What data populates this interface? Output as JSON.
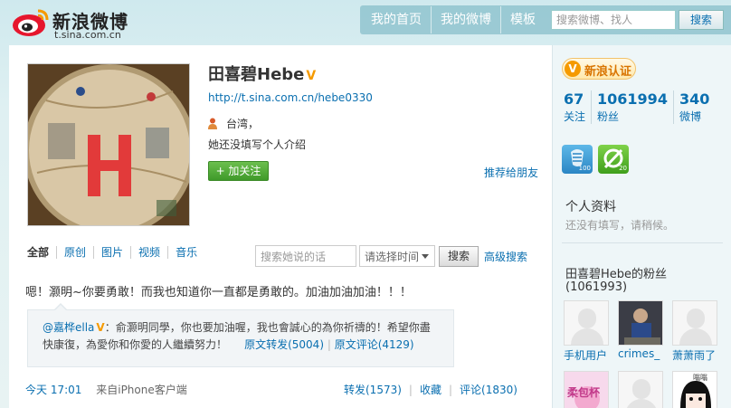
{
  "header": {
    "brand": "新浪微博",
    "site_url": "t.sina.com.cn",
    "nav": [
      "我的首页",
      "我的微博",
      "模板"
    ],
    "search_placeholder": "搜索微博、找人",
    "search_button": "搜索"
  },
  "profile": {
    "name": "田喜碧Hebe",
    "verified_mark": "V",
    "url": "http://t.sina.com.cn/hebe0330",
    "location": "台湾，",
    "bio": "她还没填写个人介绍",
    "follow_button": "+ 加关注",
    "recommend_link": "推荐给朋友"
  },
  "filters": {
    "tabs": [
      "全部",
      "原创",
      "图片",
      "视频",
      "音乐"
    ],
    "search_placeholder": "搜索她说的话",
    "time_select": "请选择时间",
    "search_button": "搜索",
    "advanced_search": "高级搜索"
  },
  "post": {
    "text": "嗯！灏明~你要勇敢！而我也知道你一直都是勇敢的。加油加油加油！！！",
    "retweet": {
      "user": "@嘉桦ella",
      "verified_mark": "V",
      "text": "：俞灏明同學，你也要加油喔，我也會誠心的為你祈禱的！希望你盡快康復，為愛你和你愛的人繼續努力！",
      "orig_repost": "原文转发(5004)",
      "orig_comment": "原文评论(4129)"
    },
    "time": "今天 17:01",
    "source": "来自iPhone客户端",
    "repost": "转发(1573)",
    "favorite": "收藏",
    "comment": "评论(1830)"
  },
  "sidebar": {
    "cert_mark": "V",
    "cert_label": "新浪认证",
    "stats": [
      {
        "num": "67",
        "label": "关注"
      },
      {
        "num": "1061994",
        "label": "粉丝"
      },
      {
        "num": "340",
        "label": "微博"
      }
    ],
    "medals": [
      {
        "icon": "medal-100-icon",
        "count": "100"
      },
      {
        "icon": "medal-20-icon",
        "count": "20"
      }
    ],
    "info_title": "个人资料",
    "info_text": "还没有填写，请稍候。",
    "fans_title": "田喜碧Hebe的粉丝",
    "fans_count": "(1061993)",
    "fans": [
      {
        "name": "手机用户"
      },
      {
        "name": "crimes_"
      },
      {
        "name": "萧萧雨了"
      },
      {
        "name": ""
      },
      {
        "name": ""
      },
      {
        "name": ""
      }
    ],
    "fan_stickers": [
      "柔包杯",
      "嗡嗡"
    ]
  },
  "colors": {
    "link": "#0a6fb0",
    "verified": "#f59a00",
    "follow_green": "#4fae34"
  }
}
